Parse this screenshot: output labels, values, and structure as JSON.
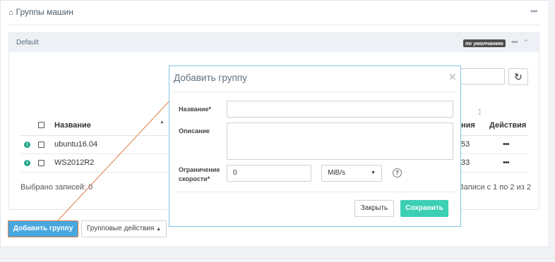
{
  "page": {
    "title": "Группы машин"
  },
  "group": {
    "name": "Default",
    "badge": "по умолчанию"
  },
  "table": {
    "columns": {
      "name": "Название",
      "speed_tail": "ния",
      "actions": "Действия"
    },
    "rows": [
      {
        "name": "ubuntu16.04",
        "tail": "53"
      },
      {
        "name": "WS2012R2",
        "tail": "33"
      }
    ],
    "selected": "Выбрано записей: 0",
    "pager": "Записи с 1 по 2 из 2"
  },
  "buttons": {
    "add_group": "Добавить группу",
    "group_actions": "Групповые действия"
  },
  "modal": {
    "title": "Добавить группу",
    "name_label": "Название*",
    "name_value": "",
    "desc_label": "Описание",
    "desc_value": "",
    "speed_label_1": "Ограничение",
    "speed_label_2": "скорости*",
    "speed_value": "0",
    "speed_unit": "MiB/s",
    "close_label": "Закрыть",
    "save_label": "Сохранить"
  },
  "icons": {
    "page": "home-icon",
    "refresh": "refresh-icon",
    "close": "close-icon",
    "help": "help-icon",
    "info": "info-icon"
  },
  "colors": {
    "primary": "#49a7e0",
    "save": "#3ccfb4",
    "info": "#25a78a",
    "annotation": "#e27c45"
  }
}
